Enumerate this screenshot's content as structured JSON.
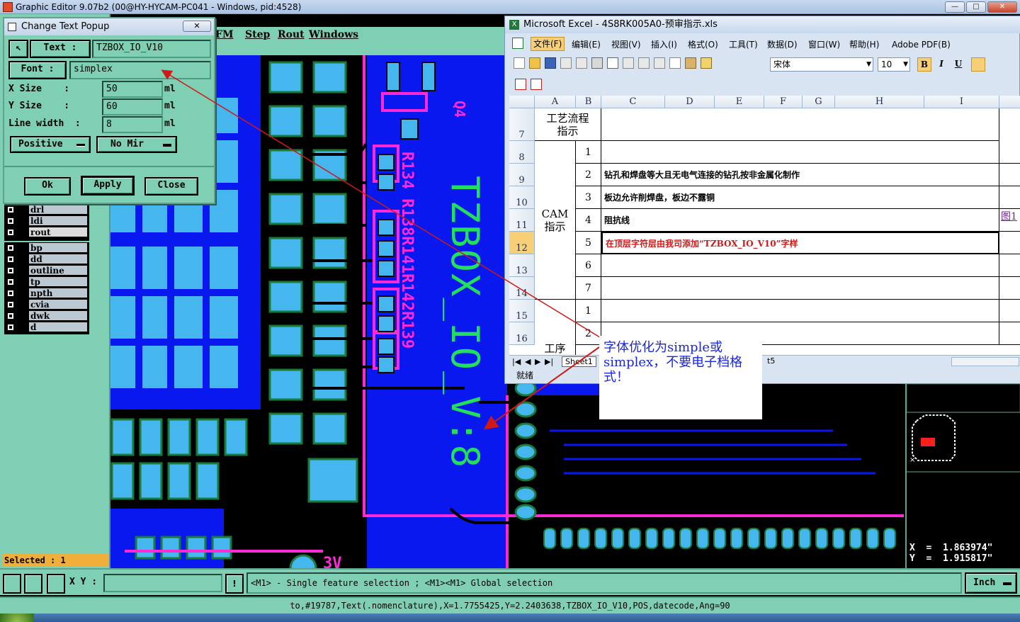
{
  "main_window": {
    "title": "Graphic Editor 9.07b2 (00@HY-HYCAM-PC041 - Windows, pid:4528)"
  },
  "genesis_menu": [
    "FM",
    "Step",
    "Rout",
    "Windows"
  ],
  "popup": {
    "title": "Change Text Popup",
    "text_button": "Text :",
    "text_value": "TZBOX_IO_V10",
    "font_button": "Font :",
    "font_value": "simplex",
    "x_size_label": "X Size    :",
    "x_size_value": "50",
    "y_size_label": "Y Size    :",
    "y_size_value": "60",
    "line_width_label": "Line width  :",
    "line_width_value": "8",
    "unit": "ml",
    "polarity": "Positive",
    "mirror": "No Mir",
    "ok": "Ok",
    "apply": "Apply",
    "close": "Close"
  },
  "layers_group1": [
    "drl",
    "ldi",
    "rout"
  ],
  "layers_group2": [
    "bp",
    "dd",
    "outline",
    "tp",
    "npth",
    "cvia",
    "dwk",
    "d"
  ],
  "selected": "Selected : 1",
  "pcb": {
    "silk_text": "TZBOX_IO_V:8",
    "refdes": "R134 R138R141R142R139",
    "q_label": "Q4",
    "label_3v": "3V"
  },
  "excel": {
    "title": "Microsoft Excel - 4S8RK005A0-预审指示.xls",
    "menu": [
      "文件(F)",
      "编辑(E)",
      "视图(V)",
      "插入(I)",
      "格式(O)",
      "工具(T)",
      "数据(D)",
      "窗口(W)",
      "帮助(H)",
      "Adobe PDF(B)"
    ],
    "font_name": "宋体",
    "font_size": "10",
    "bold": "B",
    "italic": "I",
    "underline": "U",
    "columns": [
      "A",
      "B",
      "C",
      "D",
      "E",
      "F",
      "G",
      "H",
      "I"
    ],
    "rows": [
      "7",
      "8",
      "9",
      "10",
      "11",
      "12",
      "13",
      "14",
      "15",
      "16"
    ],
    "section1": "工艺流程指示",
    "section2": "CAM指示",
    "section3": "工序",
    "items": [
      {
        "n": "1",
        "text": ""
      },
      {
        "n": "2",
        "text": "钻孔和焊盘等大且无电气连接的钻孔按非金属化制作"
      },
      {
        "n": "3",
        "text": "板边允许削焊盘，板边不露铜"
      },
      {
        "n": "4",
        "text": "阻抗线",
        "link": "图1"
      },
      {
        "n": "5",
        "text": "在顶层字符层由我司添加“TZBOX_IO_V10”字样"
      },
      {
        "n": "6",
        "text": ""
      },
      {
        "n": "7",
        "text": ""
      },
      {
        "n": "1",
        "text": ""
      },
      {
        "n": "2",
        "text": ""
      }
    ],
    "sheet_tab": "Sheet1",
    "sheet_tab2": "t5",
    "status": "就绪"
  },
  "callout": {
    "text": "字体优化为simple或simplex，不要电子档格式！"
  },
  "coords": {
    "x": "X  =  1.863974\"",
    "y": "Y  =  1.915817\""
  },
  "bottombar": {
    "xy_label": "X Y :",
    "xy_value": "",
    "hint": "<M1> - Single feature selection ; <M1><M1> Global selection",
    "units": "Inch"
  },
  "statusline": "to,#19787,Text(.nomenclature),X=1.7755425,Y=2.2403638,TZBOX_IO_V10,POS,datecode,Ang=90",
  "colors": {
    "genesis_bg": "#7ecfb3",
    "board_blue": "#0a18f0",
    "pad": "#45b6ee",
    "silk_magenta": "#ff2ad6",
    "silk_green": "#22e05a",
    "annotation_red": "#d01818"
  }
}
